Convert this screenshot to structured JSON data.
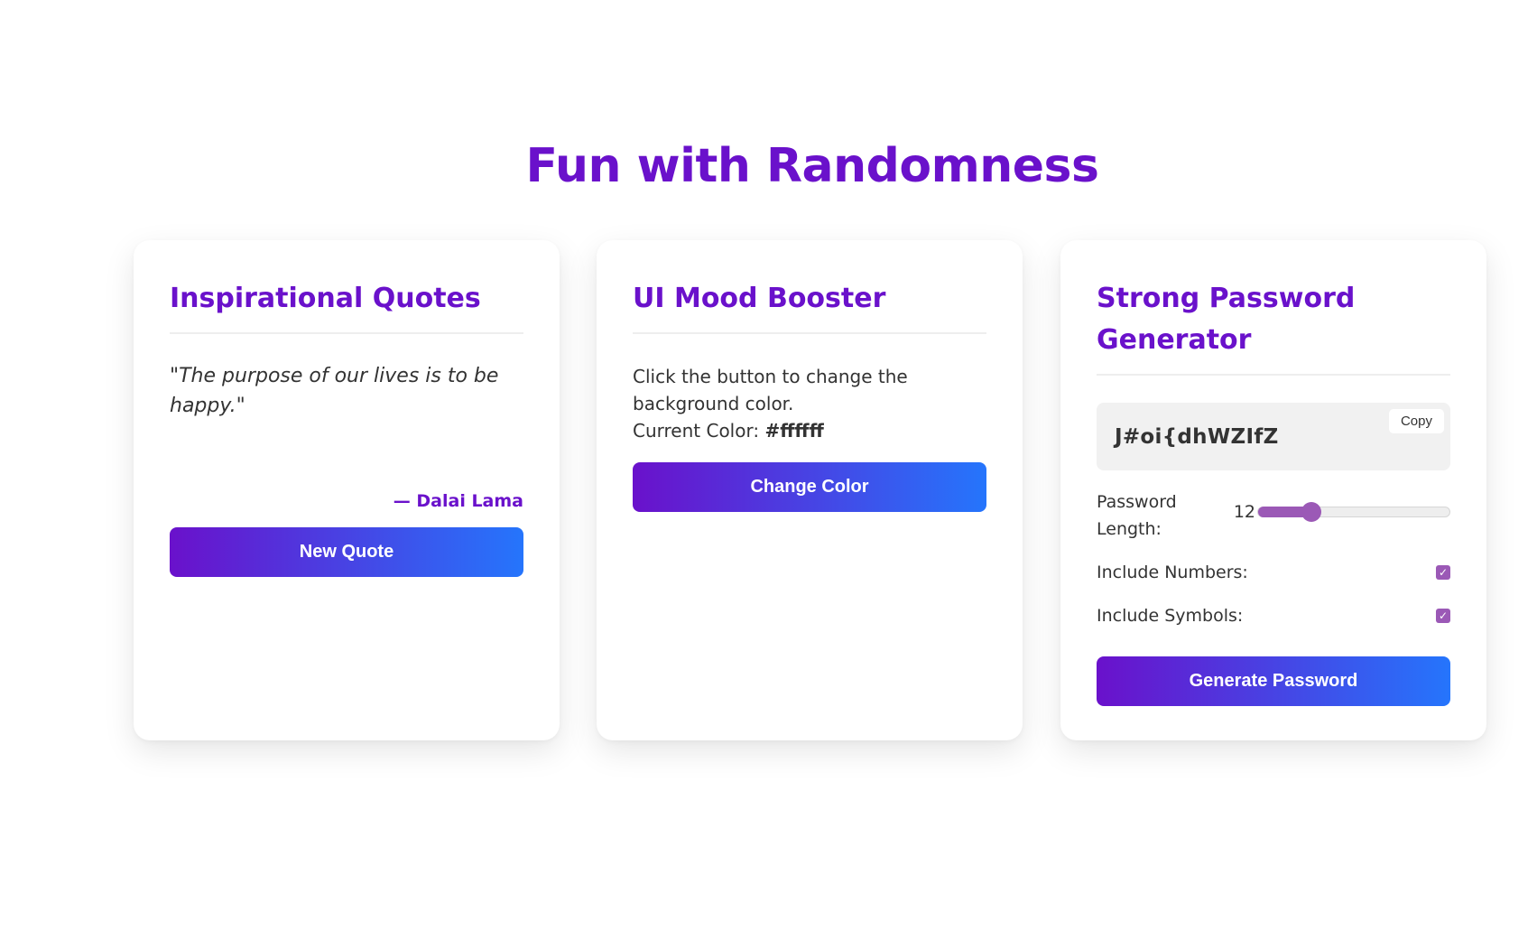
{
  "page": {
    "title": "Fun with Randomness"
  },
  "quotes_card": {
    "heading": "Inspirational Quotes",
    "quote": "\"The purpose of our lives is to be happy.\"",
    "author": "— Dalai Lama",
    "button_label": "New Quote"
  },
  "mood_card": {
    "heading": "UI Mood Booster",
    "instruction": "Click the button to change the background color.",
    "current_color_label": "Current Color:",
    "current_color_value": "#ffffff",
    "button_label": "Change Color"
  },
  "password_card": {
    "heading": "Strong Password Generator",
    "password": "J#oi{dhWZIfZ",
    "copy_label": "Copy",
    "length_label": "Password Length:",
    "length_value": "12",
    "length_slider_fraction": 0.28,
    "include_numbers_label": "Include Numbers:",
    "include_numbers_checked": true,
    "include_symbols_label": "Include Symbols:",
    "include_symbols_checked": true,
    "button_label": "Generate Password"
  },
  "colors": {
    "accent": "#6a11cb",
    "gradient_start": "#6a11cb",
    "gradient_end": "#2575fc",
    "control": "#9b59b6"
  }
}
